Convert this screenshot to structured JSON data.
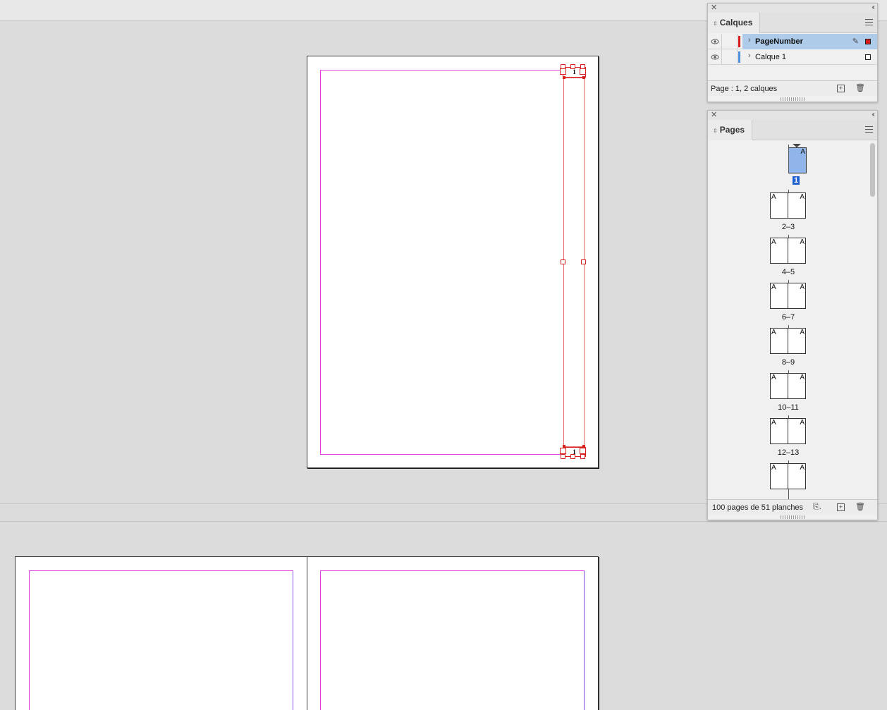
{
  "document": {
    "page_number_marker": "1"
  },
  "layers_panel": {
    "tab_label": "Calques",
    "layers": [
      {
        "name": "PageNumber",
        "color": "#d81a1a",
        "selected": true,
        "visible": true
      },
      {
        "name": "Calque 1",
        "color": "#4f8fe0",
        "selected": false,
        "visible": true
      }
    ],
    "footer_text": "Page : 1, 2 calques"
  },
  "pages_panel": {
    "tab_label": "Pages",
    "thumbnails": [
      {
        "label": "1",
        "masters": [
          "A"
        ],
        "selected": true
      },
      {
        "label": "2–3",
        "masters": [
          "A",
          "A"
        ]
      },
      {
        "label": "4–5",
        "masters": [
          "A",
          "A"
        ]
      },
      {
        "label": "6–7",
        "masters": [
          "A",
          "A"
        ]
      },
      {
        "label": "8–9",
        "masters": [
          "A",
          "A"
        ]
      },
      {
        "label": "10–11",
        "masters": [
          "A",
          "A"
        ]
      },
      {
        "label": "12–13",
        "masters": [
          "A",
          "A"
        ]
      },
      {
        "label": "",
        "masters": [
          "A",
          "A"
        ]
      }
    ],
    "footer_text": "100 pages de 51 planches"
  },
  "colors": {
    "margin_guide": "#e040e0",
    "selection": "#d82020",
    "selected_layer_bg": "#aecbea",
    "selected_page_label": "#1f5fd1"
  }
}
